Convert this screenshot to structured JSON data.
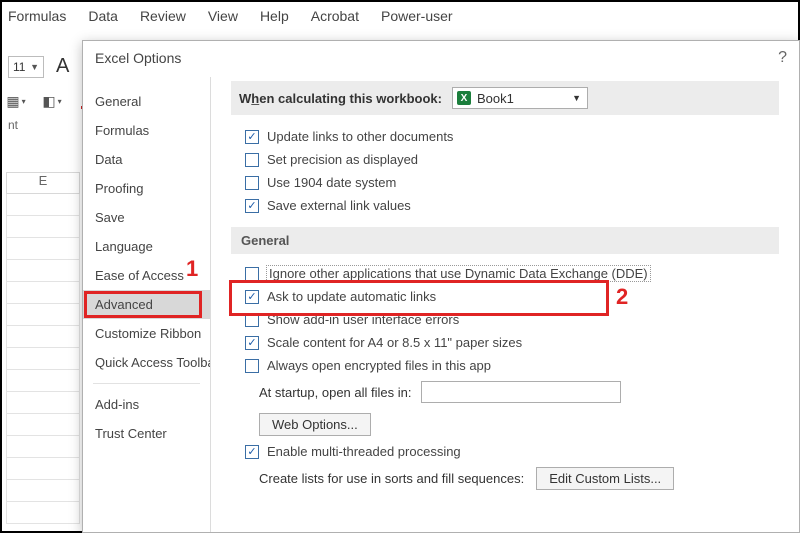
{
  "ribbon": {
    "menus": [
      "Formulas",
      "Data",
      "Review",
      "View",
      "Help",
      "Acrobat",
      "Power-user"
    ]
  },
  "font_size": "11",
  "toolbar_letter": "A",
  "small_nt": "nt",
  "column_header": "E",
  "dialog": {
    "title": "Excel Options",
    "help": "?",
    "nav": {
      "general": "General",
      "formulas": "Formulas",
      "data": "Data",
      "proofing": "Proofing",
      "save": "Save",
      "language": "Language",
      "ease": "Ease of Access",
      "advanced": "Advanced",
      "customize_ribbon": "Customize Ribbon",
      "qat": "Quick Access Toolbar",
      "addins": "Add-ins",
      "trust": "Trust Center"
    },
    "calc_label_pre": "W",
    "calc_label_u": "h",
    "calc_label_post": "en calculating this workbook:",
    "workbook_name": "Book1",
    "opts1": {
      "update_links": "Update links to other documents",
      "set_precision": "Set precision as displayed",
      "use_1904": "Use 1904 date system",
      "save_external": "Save external link values"
    },
    "section_general": "General",
    "opts2": {
      "ignore_dde": "Ignore other applications that use Dynamic Data Exchange (DDE)",
      "ask_update": "Ask to update automatic links",
      "show_addin_errors": "Show add-in user interface errors",
      "scale_content": "Scale content for A4 or 8.5 x 11\" paper sizes",
      "always_open_encrypted": "Always open encrypted files in this app"
    },
    "startup_label": "At startup, open all files in:",
    "web_options_btn": "Web Options...",
    "enable_multithread": "Enable multi-threaded processing",
    "create_lists_label": "Create lists for use in sorts and fill sequences:",
    "edit_custom_lists_btn": "Edit Custom Lists..."
  },
  "callouts": {
    "one": "1",
    "two": "2"
  }
}
